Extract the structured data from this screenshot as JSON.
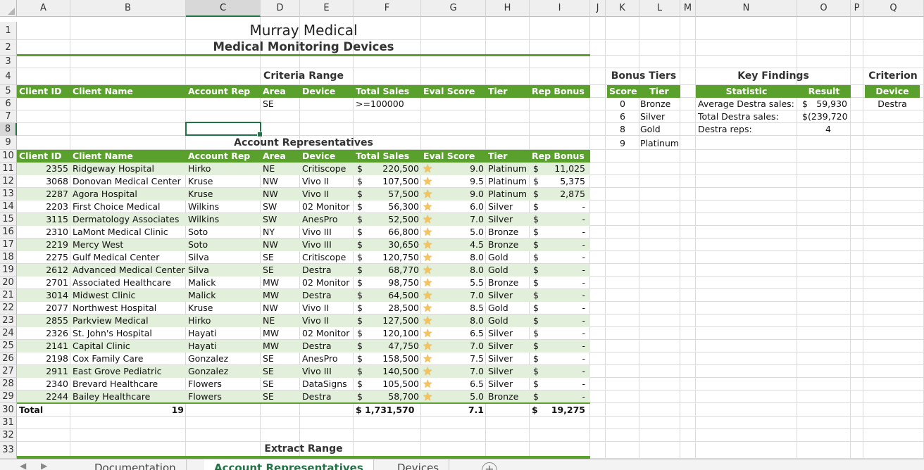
{
  "columns": [
    "A",
    "B",
    "C",
    "D",
    "E",
    "F",
    "G",
    "H",
    "I",
    "J",
    "K",
    "L",
    "M",
    "N",
    "O",
    "P",
    "Q"
  ],
  "rows": [
    "1",
    "2",
    "3",
    "4",
    "5",
    "6",
    "7",
    "8",
    "9",
    "10",
    "11",
    "12",
    "13",
    "14",
    "15",
    "16",
    "17",
    "18",
    "19",
    "20",
    "21",
    "22",
    "23",
    "24",
    "25",
    "26",
    "27",
    "28",
    "29",
    "30",
    "31",
    "32",
    "33"
  ],
  "title": "Murray Medical",
  "subtitle": "Medical Monitoring Devices",
  "criteria_range": {
    "title": "Criteria Range",
    "criteria": {
      "area": "SE",
      "total_sales": ">=100000"
    }
  },
  "headers": [
    "Client ID",
    "Client Name",
    "Account Rep",
    "Area",
    "Device",
    "Total Sales",
    "Eval Score",
    "Tier",
    "Rep Bonus"
  ],
  "account_reps": {
    "title": "Account Representatives",
    "rows": [
      {
        "id": "2355",
        "name": "Ridgeway Hospital",
        "rep": "Hirko",
        "area": "NE",
        "device": "Critiscope",
        "cur": "$",
        "sales": "220,500",
        "score": "9.0",
        "tier": "Platinum",
        "bcur": "$",
        "bonus": "11,025"
      },
      {
        "id": "3068",
        "name": "Donovan Medical Center",
        "rep": "Kruse",
        "area": "NW",
        "device": "Vivo II",
        "cur": "$",
        "sales": "107,500",
        "score": "9.5",
        "tier": "Platinum",
        "bcur": "$",
        "bonus": "5,375"
      },
      {
        "id": "2287",
        "name": "Agora Hospital",
        "rep": "Kruse",
        "area": "NW",
        "device": "Vivo II",
        "cur": "$",
        "sales": "57,500",
        "score": "9.0",
        "tier": "Platinum",
        "bcur": "$",
        "bonus": "2,875"
      },
      {
        "id": "2203",
        "name": "First Choice Medical",
        "rep": "Wilkins",
        "area": "SW",
        "device": "02 Monitor",
        "cur": "$",
        "sales": "56,300",
        "score": "6.0",
        "tier": "Silver",
        "bcur": "$",
        "bonus": "-"
      },
      {
        "id": "3115",
        "name": "Dermatology Associates",
        "rep": "Wilkins",
        "area": "SW",
        "device": "AnesPro",
        "cur": "$",
        "sales": "52,500",
        "score": "7.0",
        "tier": "Silver",
        "bcur": "$",
        "bonus": "-"
      },
      {
        "id": "2310",
        "name": "LaMont Medical Clinic",
        "rep": "Soto",
        "area": "NY",
        "device": "Vivo III",
        "cur": "$",
        "sales": "66,800",
        "score": "5.0",
        "tier": "Bronze",
        "bcur": "$",
        "bonus": "-"
      },
      {
        "id": "2219",
        "name": "Mercy West",
        "rep": "Soto",
        "area": "NW",
        "device": "Vivo III",
        "cur": "$",
        "sales": "30,650",
        "score": "4.5",
        "tier": "Bronze",
        "bcur": "$",
        "bonus": "-"
      },
      {
        "id": "2275",
        "name": "Gulf Medical Center",
        "rep": "Silva",
        "area": "SE",
        "device": "Critiscope",
        "cur": "$",
        "sales": "120,750",
        "score": "8.0",
        "tier": "Gold",
        "bcur": "$",
        "bonus": "-"
      },
      {
        "id": "2612",
        "name": "Advanced Medical Center",
        "rep": "Silva",
        "area": "SE",
        "device": "Destra",
        "cur": "$",
        "sales": "68,770",
        "score": "8.0",
        "tier": "Gold",
        "bcur": "$",
        "bonus": "-"
      },
      {
        "id": "2701",
        "name": "Associated Healthcare",
        "rep": "Malick",
        "area": "MW",
        "device": "02 Monitor",
        "cur": "$",
        "sales": "98,750",
        "score": "5.5",
        "tier": "Bronze",
        "bcur": "$",
        "bonus": "-"
      },
      {
        "id": "3014",
        "name": "Midwest Clinic",
        "rep": "Malick",
        "area": "MW",
        "device": "Destra",
        "cur": "$",
        "sales": "64,500",
        "score": "7.0",
        "tier": "Silver",
        "bcur": "$",
        "bonus": "-"
      },
      {
        "id": "2077",
        "name": "Northwest Hospital",
        "rep": "Kruse",
        "area": "NW",
        "device": "Vivo II",
        "cur": "$",
        "sales": "28,500",
        "score": "8.5",
        "tier": "Gold",
        "bcur": "$",
        "bonus": "-"
      },
      {
        "id": "2855",
        "name": "Parkview Medical",
        "rep": "Hirko",
        "area": "NE",
        "device": "Vivo II",
        "cur": "$",
        "sales": "127,500",
        "score": "8.0",
        "tier": "Gold",
        "bcur": "$",
        "bonus": "-"
      },
      {
        "id": "2326",
        "name": "St. John's Hospital",
        "rep": "Hayati",
        "area": "MW",
        "device": "02 Monitor",
        "cur": "$",
        "sales": "120,100",
        "score": "6.5",
        "tier": "Silver",
        "bcur": "$",
        "bonus": "-"
      },
      {
        "id": "2141",
        "name": "Capital Clinic",
        "rep": "Hayati",
        "area": "MW",
        "device": "Destra",
        "cur": "$",
        "sales": "47,750",
        "score": "7.0",
        "tier": "Silver",
        "bcur": "$",
        "bonus": "-"
      },
      {
        "id": "2198",
        "name": "Cox Family Care",
        "rep": "Gonzalez",
        "area": "SE",
        "device": "AnesPro",
        "cur": "$",
        "sales": "158,500",
        "score": "7.5",
        "tier": "Silver",
        "bcur": "$",
        "bonus": "-"
      },
      {
        "id": "2911",
        "name": "East Grove Pediatric",
        "rep": "Gonzalez",
        "area": "SE",
        "device": "Vivo III",
        "cur": "$",
        "sales": "140,500",
        "score": "7.0",
        "tier": "Silver",
        "bcur": "$",
        "bonus": "-"
      },
      {
        "id": "2340",
        "name": "Brevard Healthcare",
        "rep": "Flowers",
        "area": "SE",
        "device": "DataSigns",
        "cur": "$",
        "sales": "105,500",
        "score": "6.5",
        "tier": "Silver",
        "bcur": "$",
        "bonus": "-"
      },
      {
        "id": "2244",
        "name": "Bailey Healthcare",
        "rep": "Flowers",
        "area": "SE",
        "device": "Destra",
        "cur": "$",
        "sales": "58,700",
        "score": "5.0",
        "tier": "Bronze",
        "bcur": "$",
        "bonus": "-"
      }
    ],
    "total": {
      "label": "Total",
      "count": "19",
      "sales": "$ 1,731,570",
      "score": "7.1",
      "bcur": "$",
      "bonus": "19,275"
    }
  },
  "bonus_tiers": {
    "title": "Bonus Tiers",
    "headers": [
      "Score",
      "Tier"
    ],
    "rows": [
      {
        "score": "0",
        "tier": "Bronze"
      },
      {
        "score": "6",
        "tier": "Silver"
      },
      {
        "score": "8",
        "tier": "Gold"
      },
      {
        "score": "9",
        "tier": "Platinum"
      }
    ]
  },
  "key_findings": {
    "title": "Key Findings",
    "headers": [
      "Statistic",
      "Result"
    ],
    "rows": [
      {
        "stat": "Average Destra sales:",
        "cur": "$",
        "value": "59,930"
      },
      {
        "stat": "Total Destra sales:",
        "cur": "$",
        "value": "(239,720)"
      },
      {
        "stat": "Destra reps:",
        "cur": "",
        "value": "4"
      }
    ]
  },
  "criterion": {
    "title": "Criterion",
    "header": "Device",
    "value": "Destra"
  },
  "extract_range": {
    "title": "Extract Range"
  },
  "tabs": [
    "Documentation",
    "Account Representatives",
    "Devices"
  ],
  "active_tab": "Account Representatives",
  "icons": {
    "star": "star-icon",
    "add_sheet": "plus-circle-icon"
  },
  "colors": {
    "header_green": "#5aa02c",
    "band_green": "#e2efda",
    "selection": "#217346"
  }
}
